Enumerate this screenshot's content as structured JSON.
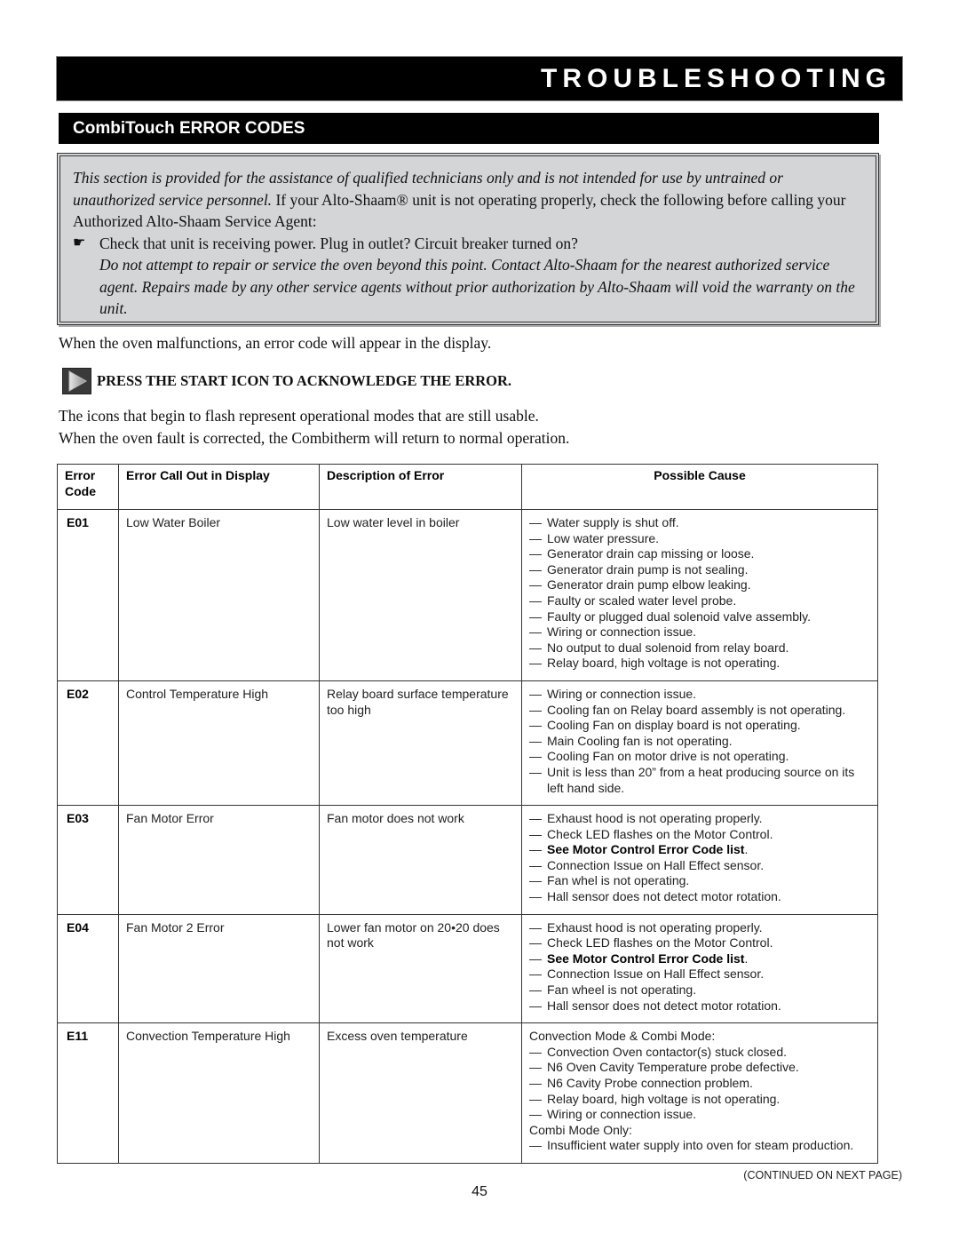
{
  "header": {
    "title": "TROUBLESHOOTING",
    "section_title": "CombiTouch ERROR CODES"
  },
  "notice": {
    "italic_intro": "This section is provided for the assistance of qualified technicians only and is not intended for use by untrained or unauthorized service personnel.",
    "text_after": " If your Alto-Shaam® unit is not operating properly, check the following before calling your Authorized Alto-Shaam Service Agent:",
    "bullet_icon": "pointing-hand-icon",
    "bullet_glyph": "☛",
    "bullet_text": "Check that unit is receiving power. Plug in outlet? Circuit breaker turned on?",
    "warning": "Do not attempt to repair or service the oven beyond this point. Contact Alto-Shaam for the nearest authorized service agent. Repairs made by any other service agents without prior authorization by Alto-Shaam will void the warranty on the unit."
  },
  "intro": {
    "malfunction_text": "When the oven malfunctions, an error code will appear in the display.",
    "press_instruction": "PRESS THE START ICON TO ACKNOWLEDGE THE ERROR.",
    "flash_text": "The icons that begin to flash represent operational modes that are still usable.",
    "corrected_text": "When the oven fault is corrected, the Combitherm will return to normal operation."
  },
  "table": {
    "headers": {
      "code": "Error Code",
      "callout": "Error Call Out in Display",
      "description": "Description of Error",
      "cause": "Possible Cause"
    },
    "rows": [
      {
        "code": "E01",
        "callout": "Low Water Boiler",
        "description": "Low water level in boiler",
        "causes": [
          {
            "type": "item",
            "text": "Water supply is shut off."
          },
          {
            "type": "item",
            "text": "Low water pressure."
          },
          {
            "type": "item",
            "text": "Generator drain cap missing or loose."
          },
          {
            "type": "item",
            "text": "Generator drain pump is not sealing."
          },
          {
            "type": "item",
            "text": "Generator drain pump elbow leaking."
          },
          {
            "type": "item",
            "text": "Faulty or scaled water level probe."
          },
          {
            "type": "item",
            "text": "Faulty or plugged dual solenoid valve assembly."
          },
          {
            "type": "item",
            "text": "Wiring or connection issue."
          },
          {
            "type": "item",
            "text": "No output to dual solenoid from relay board."
          },
          {
            "type": "item",
            "text": "Relay board, high voltage is not operating."
          }
        ]
      },
      {
        "code": "E02",
        "callout": "Control Temperature High",
        "description": "Relay board surface temperature too high",
        "causes": [
          {
            "type": "item",
            "text": "Wiring or connection issue."
          },
          {
            "type": "item",
            "text": "Cooling fan on Relay board assembly is not operating."
          },
          {
            "type": "item",
            "text": "Cooling Fan on display board is not operating."
          },
          {
            "type": "item",
            "text": "Main Cooling fan is not operating."
          },
          {
            "type": "item",
            "text": "Cooling Fan on motor drive is not operating."
          },
          {
            "type": "item",
            "text": "Unit is less than 20” from a heat producing source on its left hand side."
          }
        ]
      },
      {
        "code": "E03",
        "callout": "Fan Motor Error",
        "description": "Fan motor does not work",
        "causes": [
          {
            "type": "item",
            "text": "Exhaust hood is not operating properly."
          },
          {
            "type": "item",
            "text": "Check LED flashes on the Motor Control."
          },
          {
            "type": "bold",
            "text": "See Motor Control Error Code list",
            "suffix": "."
          },
          {
            "type": "item",
            "text": "Connection Issue on Hall Effect sensor."
          },
          {
            "type": "item",
            "text": "Fan whel is not operating."
          },
          {
            "type": "item",
            "text": "Hall sensor does not detect motor rotation."
          }
        ]
      },
      {
        "code": "E04",
        "callout": "Fan Motor 2 Error",
        "description": "Lower fan motor on 20•20 does not work",
        "causes": [
          {
            "type": "item",
            "text": "Exhaust hood is not operating properly."
          },
          {
            "type": "item",
            "text": "Check LED flashes on the Motor Control."
          },
          {
            "type": "bold",
            "text": "See Motor Control Error Code list",
            "suffix": "."
          },
          {
            "type": "item",
            "text": "Connection Issue on Hall Effect sensor."
          },
          {
            "type": "item",
            "text": "Fan wheel is not operating."
          },
          {
            "type": "item",
            "text": "Hall sensor does not detect motor rotation."
          }
        ]
      },
      {
        "code": "E11",
        "callout": "Convection Temperature High",
        "description": "Excess oven temperature",
        "causes": [
          {
            "type": "heading",
            "text": "Convection Mode & Combi Mode:"
          },
          {
            "type": "item",
            "text": "Convection Oven contactor(s) stuck closed."
          },
          {
            "type": "item",
            "text": "N6 Oven Cavity Temperature probe defective."
          },
          {
            "type": "item",
            "text": "N6 Cavity Probe connection problem."
          },
          {
            "type": "item",
            "text": "Relay board, high voltage is not operating."
          },
          {
            "type": "item",
            "text": "Wiring or connection issue."
          },
          {
            "type": "heading",
            "text": "Combi Mode Only:"
          },
          {
            "type": "item",
            "text": "Insufficient water supply into oven for steam production."
          }
        ]
      }
    ]
  },
  "footer": {
    "continued": "(CONTINUED ON NEXT PAGE)",
    "page_number": "45"
  }
}
